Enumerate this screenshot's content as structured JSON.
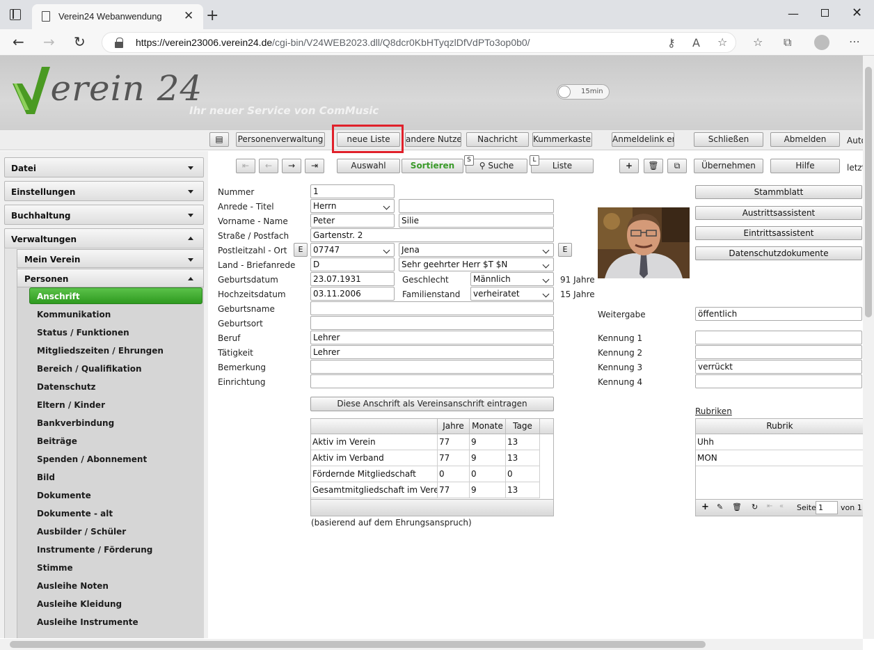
{
  "browser": {
    "tab_title": "Verein24 Webanwendung",
    "url_host": "https://verein23006.verein24.de",
    "url_path": "/cgi-bin/V24WEB2023.dll/Q8dcr0KbHTyqzlDfVdPTo3op0b0/"
  },
  "header": {
    "logo_text": "Verein24",
    "slogan": "Ihr neuer Service von ComMusic",
    "timer_label": "15min"
  },
  "toolbar": {
    "buttons": [
      "Personenverwaltung",
      "neue Liste",
      "andere Nutzer",
      "Nachricht",
      "Kummerkasten",
      "Anmeldelink erst",
      "Schließen",
      "Abmelden"
    ],
    "cut_label": "Auto"
  },
  "actionbar": {
    "auswahl": "Auswahl",
    "sortieren": "Sortieren",
    "suche": "Suche",
    "suche_key": "S",
    "liste": "Liste",
    "liste_key": "L",
    "uebernehmen": "Übernehmen",
    "hilfe": "Hilfe",
    "cut_label": "letzt"
  },
  "sidebar": {
    "sections": [
      "Datei",
      "Einstellungen",
      "Buchhaltung",
      "Verwaltungen"
    ],
    "sub_sections": [
      "Mein Verein",
      "Personen"
    ],
    "active_item": "Anschrift",
    "items": [
      "Kommunikation",
      "Status / Funktionen",
      "Mitgliedszeiten / Ehrungen",
      "Bereich / Qualifikation",
      "Datenschutz",
      "Eltern / Kinder",
      "Bankverbindung",
      "Beiträge",
      "Spenden / Abonnement",
      "Bild",
      "Dokumente",
      "Dokumente - alt",
      "Ausbilder / Schüler",
      "Instrumente / Förderung",
      "Stimme",
      "Ausleihe Noten",
      "Ausleihe Kleidung",
      "Ausleihe Instrumente"
    ]
  },
  "form": {
    "labels": {
      "nummer": "Nummer",
      "anrede": "Anrede - Titel",
      "name": "Vorname - Name",
      "strasse": "Straße / Postfach",
      "plz": "Postleitzahl - Ort",
      "land": "Land - Briefanrede",
      "geburtsdatum": "Geburtsdatum",
      "hochzeitsdatum": "Hochzeitsdatum",
      "geburtsname": "Geburtsname",
      "geburtsort": "Geburtsort",
      "beruf": "Beruf",
      "taetigkeit": "Tätigkeit",
      "bemerkung": "Bemerkung",
      "einrichtung": "Einrichtung",
      "geschlecht": "Geschlecht",
      "familienstand": "Familienstand"
    },
    "values": {
      "nummer": "1",
      "anrede": "Herrn",
      "titel": "",
      "vorname": "Peter",
      "name": "Silie",
      "strasse": "Gartenstr. 2",
      "plz": "07747",
      "ort": "Jena",
      "land": "D",
      "briefanrede": "Sehr geehrter Herr $T $N",
      "geburtsdatum": "23.07.1931",
      "alter": "91 Jahre",
      "hochzeitsdatum": "03.11.2006",
      "ehejahre": "15 Jahre",
      "geschlecht": "Männlich",
      "familienstand": "verheiratet",
      "geburtsname": "",
      "geburtsort": "",
      "beruf": "Lehrer",
      "taetigkeit": "Lehrer",
      "bemerkung": "",
      "einrichtung": ""
    },
    "e_button": "E",
    "vereinsanschrift_button": "Diese Anschrift als Vereinsanschrift eintragen"
  },
  "membership_table": {
    "columns": [
      "",
      "Jahre",
      "Monate",
      "Tage"
    ],
    "rows": [
      [
        "Aktiv im Verein",
        "77",
        "9",
        "13"
      ],
      [
        "Aktiv im Verband",
        "77",
        "9",
        "13"
      ],
      [
        "Fördernde Mitgliedschaft",
        "0",
        "0",
        "0"
      ],
      [
        "Gesamtmitgliedschaft im Verein",
        "77",
        "9",
        "13"
      ]
    ],
    "footnote": "(basierend auf dem Ehrungsanspruch)"
  },
  "right_panel": {
    "buttons": [
      "Stammblatt",
      "Austrittsassistent",
      "Eintrittsassistent",
      "Datenschutzdokumente"
    ],
    "weitergabe_label": "Weitergabe",
    "weitergabe_value": "öffentlich",
    "kennung_labels": [
      "Kennung 1",
      "Kennung 2",
      "Kennung 3",
      "Kennung 4"
    ],
    "kennung_values": [
      "",
      "",
      "verrückt",
      ""
    ],
    "rubriken_link": "Rubriken",
    "rubrik_header": "Rubrik",
    "rubrik_rows": [
      "Uhh",
      "MON"
    ],
    "pager_label": "Seite",
    "pager_value": "1",
    "pager_of": "von 1"
  }
}
